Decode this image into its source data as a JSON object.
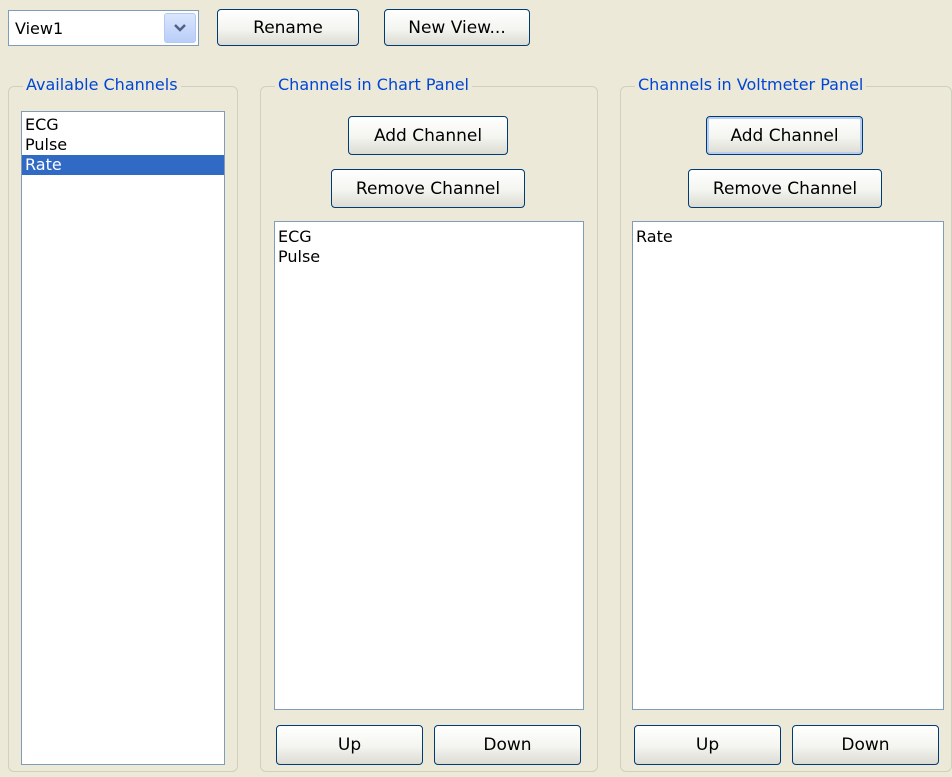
{
  "view_selector": {
    "value": "View1"
  },
  "toolbar": {
    "rename_label": "Rename",
    "new_view_label": "New View..."
  },
  "available": {
    "title": "Available Channels",
    "items": [
      "ECG",
      "Pulse",
      "Rate"
    ],
    "selected": "Rate"
  },
  "chart_panel": {
    "title": "Channels in Chart Panel",
    "add_label": "Add Channel",
    "remove_label": "Remove Channel",
    "items": [
      "ECG",
      "Pulse"
    ],
    "up_label": "Up",
    "down_label": "Down"
  },
  "voltmeter_panel": {
    "title": "Channels in Voltmeter Panel",
    "add_label": "Add Channel",
    "remove_label": "Remove Channel",
    "items": [
      "Rate"
    ],
    "up_label": "Up",
    "down_label": "Down"
  },
  "colors": {
    "group_title": "#0046d5",
    "selection": "#316ac5",
    "background": "#ece9d8"
  },
  "icons": {
    "combo_arrow": "chevron-down-icon"
  }
}
